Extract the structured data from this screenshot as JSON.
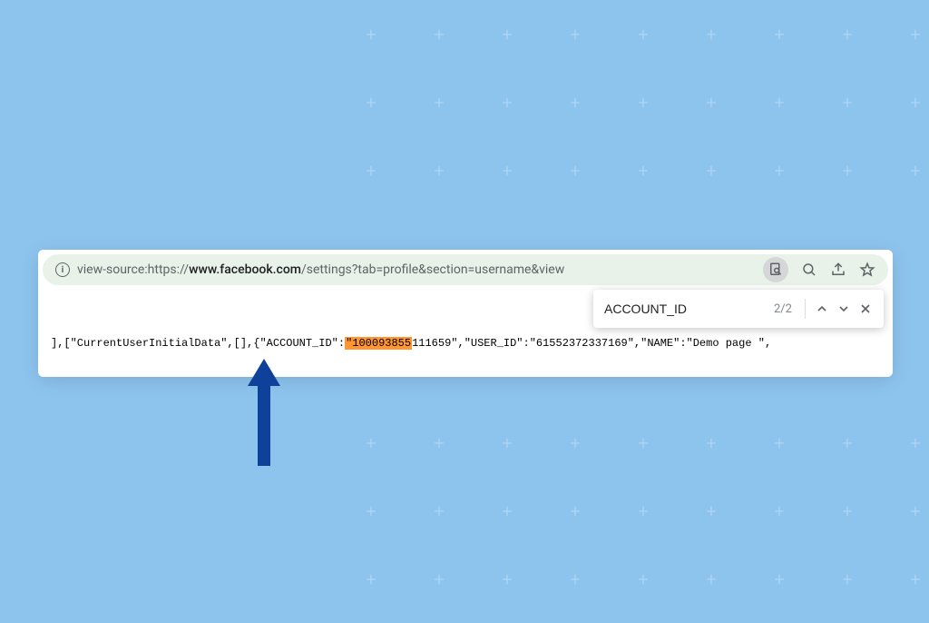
{
  "address_bar": {
    "prefix": "view-source:https://",
    "bold": "www.facebook.com",
    "suffix": "/settings?tab=profile&section=username&view"
  },
  "find": {
    "query": "ACCOUNT_ID",
    "count": "2/2"
  },
  "source": {
    "pre": "],[\"CurrentUserInitialData\",[],{\"ACCOUNT_ID\":",
    "highlighted": "\"100093855",
    "post": "111659\",\"USER_ID\":\"61552372337169\",\"NAME\":\"Demo page \","
  }
}
